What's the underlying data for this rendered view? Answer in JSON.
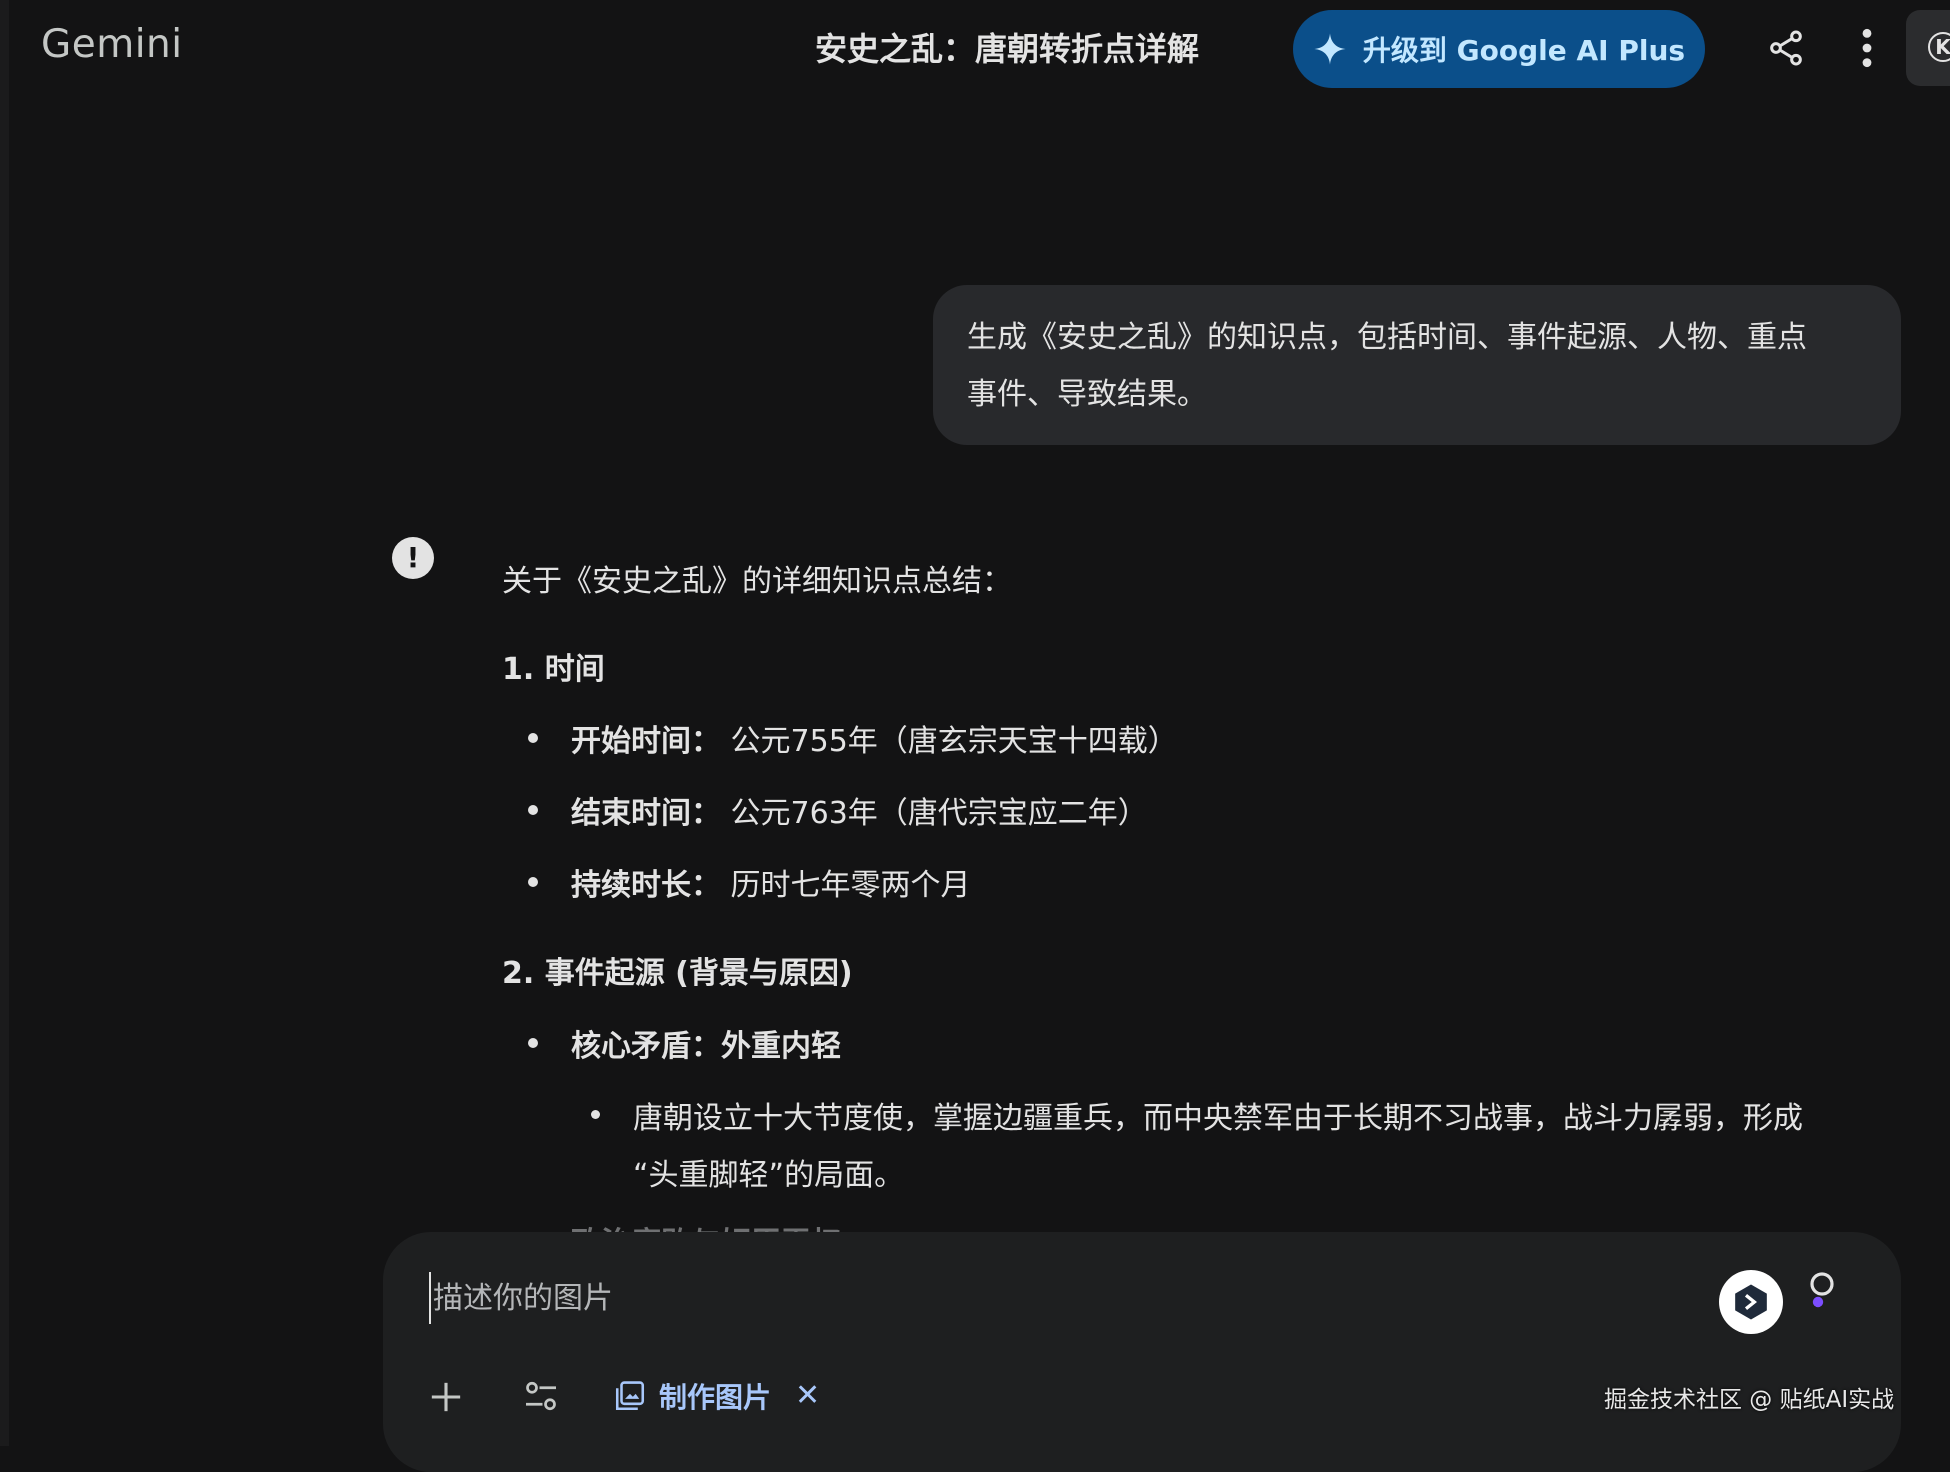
{
  "app": {
    "name": "Gemini"
  },
  "header": {
    "title": "安史之乱：唐朝转折点详解",
    "upgrade_label": "升级到 Google AI Plus",
    "avatar_initial": "K"
  },
  "user_message": {
    "line1": "生成《安史之乱》的知识点，包括时间、事件起源、人物、重点",
    "line2": "事件、导致结果。"
  },
  "response": {
    "intro": "关于《安史之乱》的详细知识点总结：",
    "section1": {
      "heading": "1. 时间",
      "items": [
        {
          "label": "开始时间：",
          "value": "公元755年（唐玄宗天宝十四载）"
        },
        {
          "label": "结束时间：",
          "value": "公元763年（唐代宗宝应二年）"
        },
        {
          "label": "持续时长：",
          "value": "历时七年零两个月"
        }
      ]
    },
    "section2": {
      "heading": "2. 事件起源 (背景与原因)",
      "item_label": "核心矛盾：外重内轻",
      "sub_line1": "唐朝设立十大节度使，掌握边疆重兵，而中央禁军由于长期不习战事，战斗力孱弱，形成",
      "sub_line2": "“头重脚轻”的局面。",
      "next_item_partial": "政治腐败与奸臣弄权"
    }
  },
  "composer": {
    "placeholder": "描述你的图片",
    "make_image_label": "制作图片",
    "close_symbol": "✕"
  },
  "watermark": "掘金技术社区 @ 贴纸AI实战",
  "colors": {
    "background": "#131314",
    "upgrade_button": "#0b4f8a",
    "accent": "#a8c7fa"
  }
}
